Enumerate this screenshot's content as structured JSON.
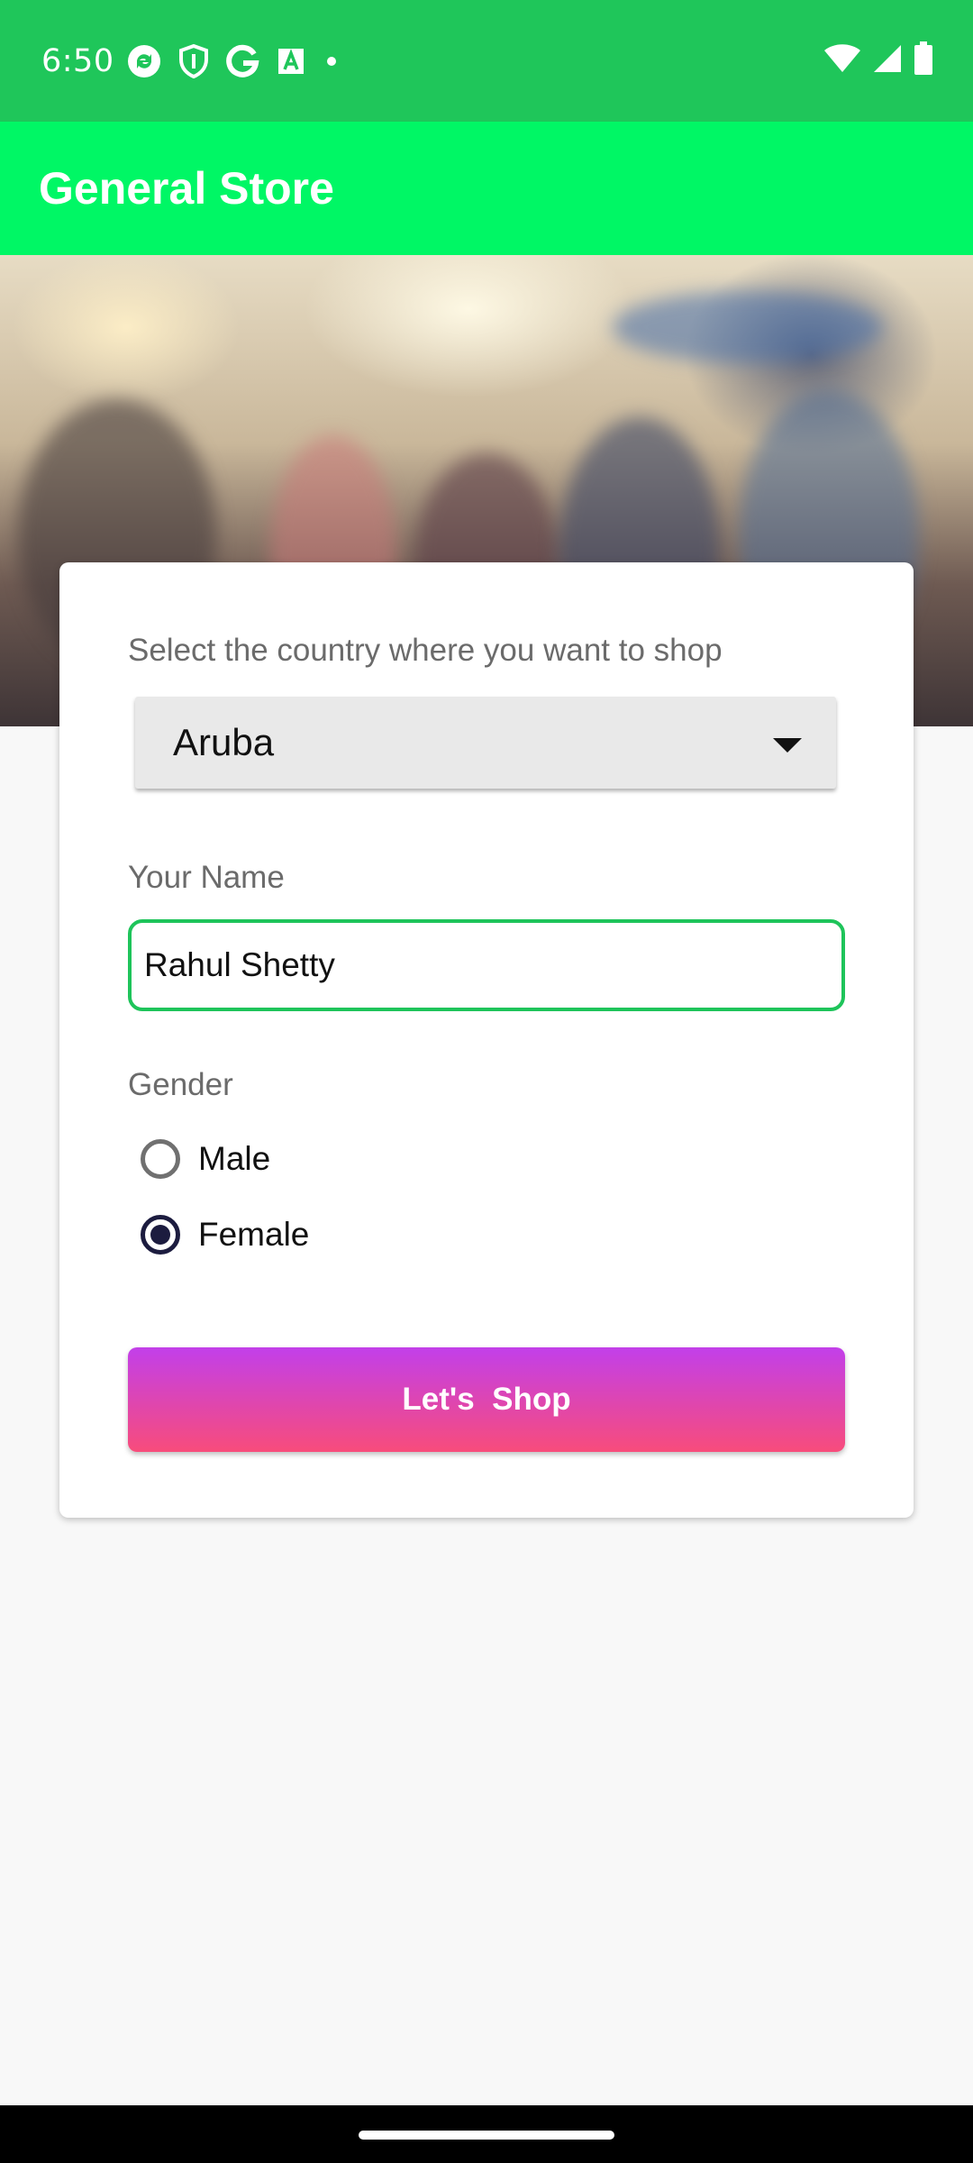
{
  "status_bar": {
    "time": "6:50",
    "left_icons": [
      "sync-icon",
      "shield-icon",
      "google-icon",
      "font-icon",
      "dot-icon"
    ],
    "right_icons": [
      "wifi-icon",
      "signal-icon",
      "battery-icon"
    ],
    "color": "#1fc65a"
  },
  "app_bar": {
    "title": "General Store",
    "color": "#00f765"
  },
  "form": {
    "country_label": "Select the country where you want to shop",
    "country_value": "Aruba",
    "name_label": "Your Name",
    "name_value": "Rahul Shetty",
    "gender_label": "Gender",
    "gender_options": [
      {
        "label": "Male",
        "selected": false
      },
      {
        "label": "Female",
        "selected": true
      }
    ],
    "submit_label": "Let's  Shop",
    "accent_color": "#1ec45a",
    "button_gradient": [
      "#c23fea",
      "#f84c7b"
    ]
  },
  "nav_bar": {
    "home_indicator": "home-handle"
  }
}
